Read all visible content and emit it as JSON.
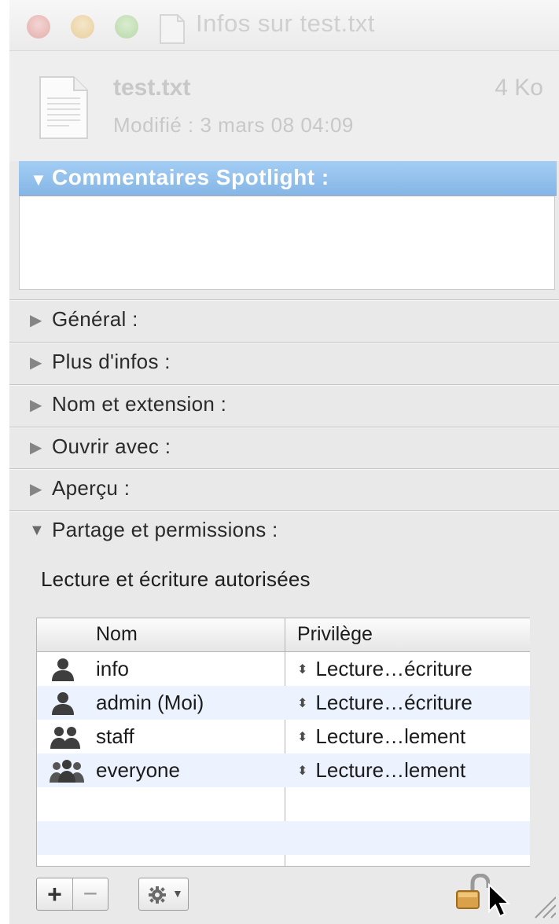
{
  "window": {
    "title": "Infos sur test.txt",
    "traffic_lights": [
      "close",
      "minimize",
      "zoom"
    ]
  },
  "file": {
    "name": "test.txt",
    "size": "4 Ko",
    "modified": "Modifié : 3 mars 08 04:09",
    "icon": "text-document-icon"
  },
  "spotlight": {
    "header": "Commentaires Spotlight :",
    "expanded": true,
    "comment": ""
  },
  "sections": {
    "general": "Général :",
    "more_info": "Plus d'infos :",
    "name_extension": "Nom et extension :",
    "open_with": "Ouvrir avec :",
    "preview": "Aperçu :",
    "sharing": "Partage et permissions :"
  },
  "sharing": {
    "status": "Lecture et écriture autorisées",
    "columns": {
      "name": "Nom",
      "privilege": "Privilège"
    },
    "rows": [
      {
        "name": "info",
        "privilege": "Lecture…écriture",
        "icon": "user-icon"
      },
      {
        "name": "admin (Moi)",
        "privilege": "Lecture…écriture",
        "icon": "user-icon"
      },
      {
        "name": "staff",
        "privilege": "Lecture…lement",
        "icon": "group-icon"
      },
      {
        "name": "everyone",
        "privilege": "Lecture…lement",
        "icon": "everyone-icon"
      }
    ]
  },
  "toolbar": {
    "add_label": "+",
    "remove_label": "−",
    "action_icon": "gear-icon",
    "lock_icon": "padlock-unlocked-icon"
  },
  "colors": {
    "spotlight_header": "#8fbdeb",
    "alt_row": "#ecf3fe",
    "window_bg": "#e9e9e9"
  }
}
